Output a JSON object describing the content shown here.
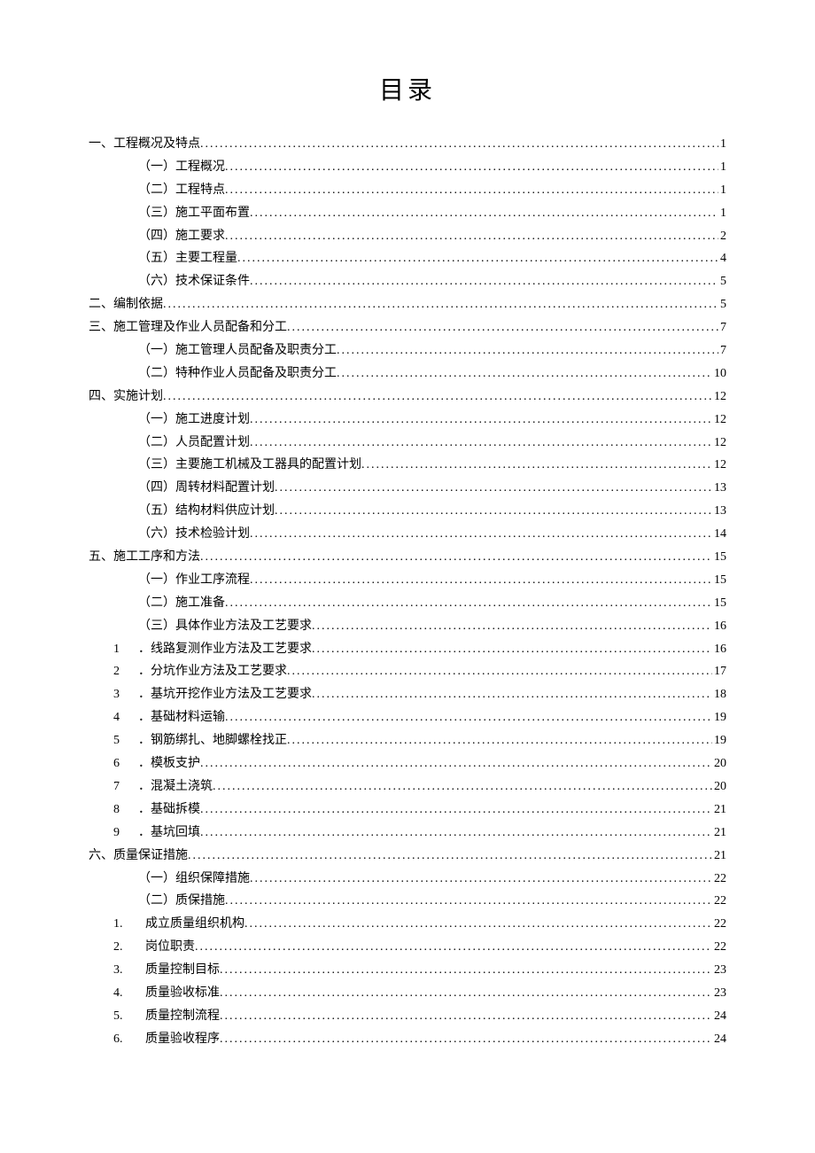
{
  "title": "目录",
  "entries": [
    {
      "indent": 0,
      "label": "一、工程概况及特点",
      "page": "1"
    },
    {
      "indent": 1,
      "label": "（一）工程概况 ",
      "page": "1"
    },
    {
      "indent": 1,
      "label": "（二）工程特点 ",
      "page": "1"
    },
    {
      "indent": 1,
      "label": "（三）施工平面布置 ",
      "page": "1"
    },
    {
      "indent": 1,
      "label": "（四）施工要求 ",
      "page": "2"
    },
    {
      "indent": 1,
      "label": "（五）主要工程量 ",
      "page": "4"
    },
    {
      "indent": 1,
      "label": "（六）技术保证条件 ",
      "page": "5"
    },
    {
      "indent": 0,
      "label": "二、编制依据",
      "page": "5"
    },
    {
      "indent": 0,
      "label": "三、施工管理及作业人员配备和分工",
      "page": "7"
    },
    {
      "indent": 1,
      "label": "（一）施工管理人员配备及职责分工 ",
      "page": "7"
    },
    {
      "indent": 1,
      "label": "（二）特种作业人员配备及职责分工 ",
      "page": "10"
    },
    {
      "indent": 0,
      "label": "四、实施计划",
      "page": "12"
    },
    {
      "indent": 1,
      "label": "（一）施工进度计划 ",
      "page": "12"
    },
    {
      "indent": 1,
      "label": "（二）人员配置计划 ",
      "page": "12"
    },
    {
      "indent": 1,
      "label": "（三）主要施工机械及工器具的配置计划 ",
      "page": "12"
    },
    {
      "indent": 1,
      "label": "（四）周转材料配置计划 ",
      "page": "13"
    },
    {
      "indent": 1,
      "label": "（五）结构材料供应计划 ",
      "page": "13"
    },
    {
      "indent": 1,
      "label": "（六）技术检验计划 ",
      "page": "14"
    },
    {
      "indent": 0,
      "label": "五、施工工序和方法",
      "page": "15"
    },
    {
      "indent": 1,
      "label": "（一）作业工序流程 ",
      "page": "15"
    },
    {
      "indent": 1,
      "label": "（二）施工准备 ",
      "page": "15"
    },
    {
      "indent": 1,
      "label": "（三）具体作业方法及工艺要求 ",
      "page": "16"
    },
    {
      "indent": 2,
      "num": "1",
      "label": "．线路复测作业方法及工艺要求 ",
      "page": "16"
    },
    {
      "indent": 2,
      "num": "2",
      "label": "．分坑作业方法及工艺要求",
      "page": "17"
    },
    {
      "indent": 2,
      "num": "3",
      "label": "．基坑开挖作业方法及工艺要求",
      "page": "18"
    },
    {
      "indent": 2,
      "num": "4",
      "label": "．基础材料运输 ",
      "page": "19"
    },
    {
      "indent": 2,
      "num": "5",
      "label": "．钢筋绑扎、地脚螺栓找正",
      "page": "19"
    },
    {
      "indent": 2,
      "num": "6",
      "label": "．模板支护 ",
      "page": "20"
    },
    {
      "indent": 2,
      "num": "7",
      "label": "．混凝土浇筑",
      "page": "20"
    },
    {
      "indent": 2,
      "num": "8",
      "label": "．基础拆模 ",
      "page": "21"
    },
    {
      "indent": 2,
      "num": "9",
      "label": "．基坑回填 ",
      "page": "21"
    },
    {
      "indent": 0,
      "label": "六、质量保证措施",
      "page": "21"
    },
    {
      "indent": 1,
      "label": "（一）组织保障措施 ",
      "page": "22"
    },
    {
      "indent": 1,
      "label": "（二）质保措施 ",
      "page": "22"
    },
    {
      "indent": 3,
      "num": "1.",
      "label": "成立质量组织机构 ",
      "page": "22"
    },
    {
      "indent": 3,
      "num": "2.",
      "label": "岗位职责 ",
      "page": "22"
    },
    {
      "indent": 3,
      "num": "3.",
      "label": "质量控制目标 ",
      "page": "23"
    },
    {
      "indent": 3,
      "num": "4.",
      "label": "质量验收标准 ",
      "page": "23"
    },
    {
      "indent": 3,
      "num": "5.",
      "label": "质量控制流程 ",
      "page": "24"
    },
    {
      "indent": 3,
      "num": "6.",
      "label": "质量验收程序 ",
      "page": "24"
    }
  ]
}
